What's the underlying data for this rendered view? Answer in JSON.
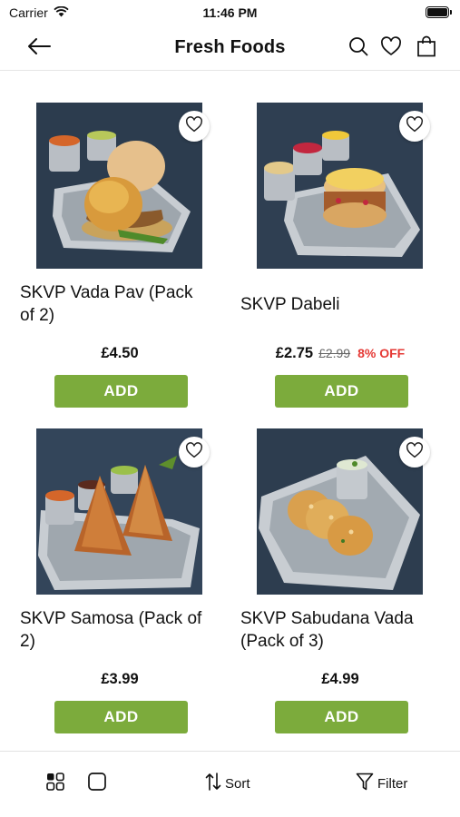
{
  "status_bar": {
    "carrier": "Carrier",
    "time": "11:46 PM"
  },
  "nav": {
    "title": "Fresh Foods",
    "back_icon": "arrow-left-icon",
    "search_icon": "search-icon",
    "wishlist_icon": "heart-icon",
    "bag_icon": "shopping-bag-icon"
  },
  "products": [
    {
      "name": "SKVP Vada Pav (Pack of 2)",
      "price": "£4.50",
      "old_price": "",
      "discount": "",
      "add_label": "ADD"
    },
    {
      "name": "SKVP Dabeli",
      "price": "£2.75",
      "old_price": "£2.99",
      "discount": "8% OFF",
      "add_label": "ADD"
    },
    {
      "name": "SKVP Samosa (Pack of 2)",
      "price": "£3.99",
      "old_price": "",
      "discount": "",
      "add_label": "ADD"
    },
    {
      "name": "SKVP Sabudana Vada (Pack of 3)",
      "price": "£4.99",
      "old_price": "",
      "discount": "",
      "add_label": "ADD"
    }
  ],
  "bottom_bar": {
    "sort_label": "Sort",
    "filter_label": "Filter"
  },
  "colors": {
    "accent_green": "#7cab3c",
    "discount_red": "#e53935"
  }
}
